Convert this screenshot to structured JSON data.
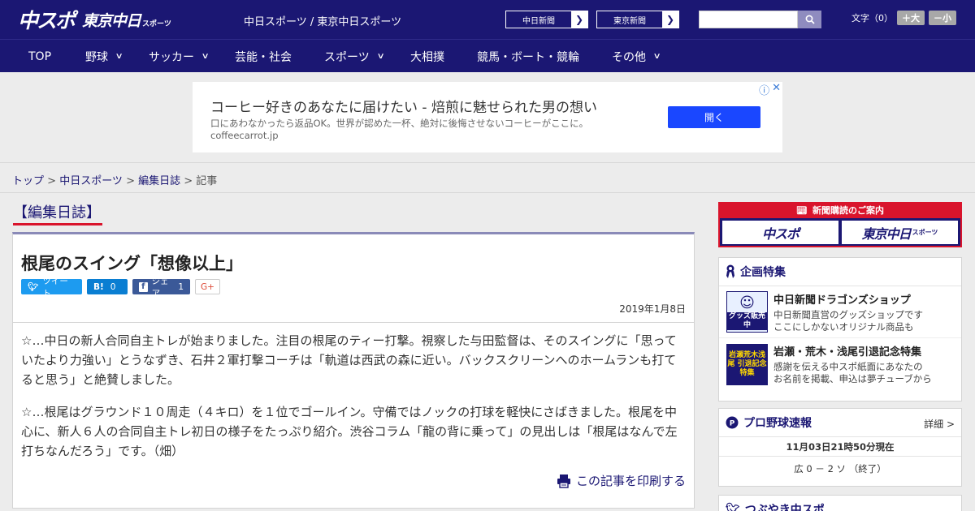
{
  "header": {
    "logo_main": "中スポ",
    "logo_sub": "東京中日",
    "logo_sub_small": "スポーツ",
    "site_title": "中日スポーツ / 東京中日スポーツ",
    "paper_links": [
      {
        "label": "中日新聞"
      },
      {
        "label": "東京新聞"
      }
    ],
    "font_size_label": "文字（0）",
    "font_up": "＋大",
    "font_down": "－小",
    "brand_color": "#1b1773"
  },
  "nav": {
    "items": [
      {
        "label": "TOP",
        "has_menu": false
      },
      {
        "label": "野球",
        "has_menu": true
      },
      {
        "label": "サッカー",
        "has_menu": true
      },
      {
        "label": "芸能・社会",
        "has_menu": false
      },
      {
        "label": "スポーツ",
        "has_menu": true
      },
      {
        "label": "大相撲",
        "has_menu": false
      },
      {
        "label": "競馬・ボート・競輪",
        "has_menu": false
      },
      {
        "label": "その他",
        "has_menu": true
      }
    ]
  },
  "ad": {
    "title": "コーヒー好きのあなたに届けたい - 焙煎に魅せられた男の想い",
    "description": "口にあわなかったら返品OK。世界が認めた一杯、絶対に後悔させないコーヒーがここに。",
    "domain": "coffeecarrot.jp",
    "button": "開く"
  },
  "breadcrumb": {
    "items": [
      "トップ",
      "中日スポーツ",
      "編集日誌"
    ],
    "current": "記事"
  },
  "article": {
    "section": "【編集日誌】",
    "title": "根尾のスイング「想像以上」",
    "share": {
      "tweet": "ツイート",
      "hatena_count": "0",
      "facebook": "シェア",
      "facebook_count": "1",
      "gplus": "G+"
    },
    "date": "2019年1月8日",
    "paragraphs": [
      "☆…中日の新人合同自主トレが始まりました。注目の根尾のティー打撃。視察した与田監督は、そのスイングに「思っていたより力強い」とうなずき、石井２軍打撃コーチは「軌道は西武の森に近い。バックスクリーンへのホームランも打てると思う」と絶賛しました。",
      "☆…根尾はグラウンド１０周走（４キロ）を１位でゴールイン。守備ではノックの打球を軽快にさばきました。根尾を中心に、新人６人の合同自主トレ初日の様子をたっぷり紹介。渋谷コラム「龍の背に乗って」の見出しは「根尾はなんで左打ちなんだろう」です。（畑）"
    ],
    "print": "この記事を印刷する"
  },
  "sidebar": {
    "subscribe": {
      "head": "新聞購読のご案内",
      "logo1": "中スポ",
      "logo2": "東京中日",
      "logo2_small": "スポーツ"
    },
    "features": {
      "title": "企画特集",
      "items": [
        {
          "thumb": "グッズ販売中",
          "title": "中日新聞ドラゴンズショップ",
          "desc1": "中日新聞直営のグッズショップです",
          "desc2": "ここにしかないオリジナル商品も"
        },
        {
          "thumb": "岩瀬荒木浅尾 引退記念特集",
          "title": "岩瀬・荒木・浅尾引退記念特集",
          "desc1": "感謝を伝える中スポ紙面にあなたの",
          "desc2": "お名前を掲載、申込は夢チューブから"
        }
      ]
    },
    "scores": {
      "title": "プロ野球速報",
      "more": "詳細 >",
      "date": "11月03日21時50分現在",
      "row": "広 0 － 2 ソ （終了）"
    },
    "tsubuyaki": {
      "title": "つぶやき中スポ"
    }
  }
}
